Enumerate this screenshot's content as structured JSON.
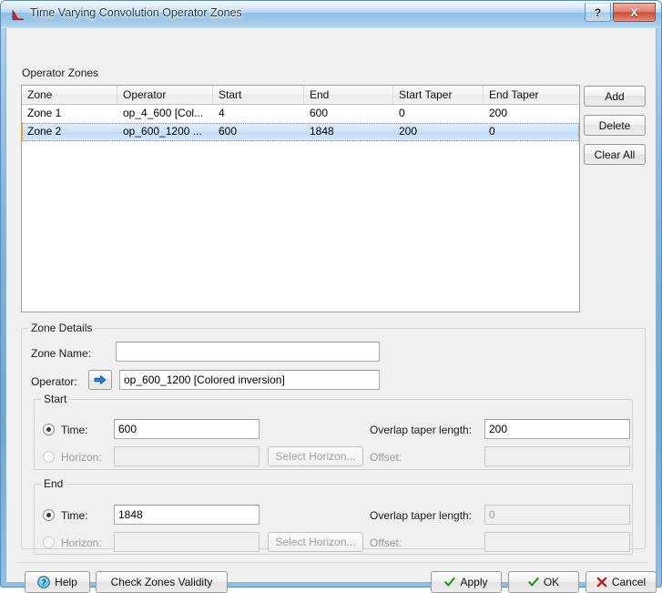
{
  "window": {
    "title": "Time Varying Convolution Operator Zones",
    "app_icon": "waveform-icon",
    "help_button": "?",
    "close_button": "X"
  },
  "operator_zones": {
    "group_label": "Operator Zones",
    "columns": [
      "Zone",
      "Operator",
      "Start",
      "End",
      "Start Taper",
      "End Taper"
    ],
    "rows": [
      {
        "zone": "Zone 1",
        "operator": "op_4_600 [Col...",
        "start": "4",
        "end": "600",
        "start_taper": "0",
        "end_taper": "200",
        "selected": false
      },
      {
        "zone": "Zone 2",
        "operator": "op_600_1200 ...",
        "start": "600",
        "end": "1848",
        "start_taper": "200",
        "end_taper": "0",
        "selected": true
      }
    ],
    "buttons": {
      "add": "Add",
      "delete": "Delete",
      "clear_all": "Clear All"
    }
  },
  "zone_details": {
    "group_label": "Zone Details",
    "zone_name_label": "Zone Name:",
    "zone_name_value": "",
    "operator_label": "Operator:",
    "operator_value": "op_600_1200 [Colored inversion]",
    "operator_browse_icon": "arrow-right-icon",
    "start": {
      "group_label": "Start",
      "time_label": "Time:",
      "time_value": "600",
      "time_selected": true,
      "horizon_label": "Horizon:",
      "horizon_value": "",
      "horizon_selected": false,
      "select_horizon_button": "Select Horizon...",
      "overlap_label": "Overlap taper length:",
      "overlap_value": "200",
      "overlap_disabled": false,
      "offset_label": "Offset:",
      "offset_value": "",
      "offset_disabled": true
    },
    "end": {
      "group_label": "End",
      "time_label": "Time:",
      "time_value": "1848",
      "time_selected": true,
      "horizon_label": "Horizon:",
      "horizon_value": "",
      "horizon_selected": false,
      "select_horizon_button": "Select Horizon...",
      "overlap_label": "Overlap taper length:",
      "overlap_value": "0",
      "overlap_disabled": true,
      "offset_label": "Offset:",
      "offset_value": "",
      "offset_disabled": true
    }
  },
  "footer": {
    "help": "Help",
    "help_icon": "question-circle-icon",
    "check_zones_validity": "Check Zones Validity",
    "apply": "Apply",
    "apply_icon": "check-icon",
    "ok": "OK",
    "ok_icon": "check-icon",
    "cancel": "Cancel",
    "cancel_icon": "x-icon"
  },
  "colors": {
    "title_bar_blue": "#8dbde6",
    "close_red": "#c8503c",
    "selection_blue": "#cde2f8",
    "check_green": "#1a8f1a",
    "cancel_red": "#c01818",
    "arrow_blue": "#1e6fd0"
  }
}
